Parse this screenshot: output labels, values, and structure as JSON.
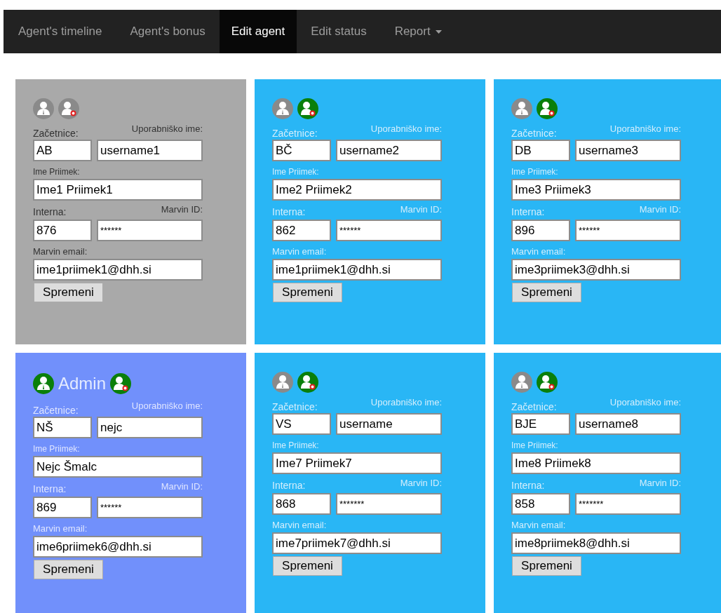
{
  "nav": [
    {
      "label": "Agent's timeline",
      "selected": false,
      "kind": "link"
    },
    {
      "label": "Agent's bonus",
      "selected": false,
      "kind": "link"
    },
    {
      "label": "Edit agent",
      "selected": true,
      "kind": "link"
    },
    {
      "label": "Edit status",
      "selected": false,
      "kind": "link"
    },
    {
      "label": "Report",
      "selected": false,
      "kind": "dropdown"
    }
  ],
  "cards": [
    {
      "kind": "inactive",
      "agent_icon_active": false,
      "status_icon_active": false,
      "initials_label": "Začetnice:",
      "initials": "AB",
      "username_label": "Uporabniško ime:",
      "username": "username1",
      "name_label": "Ime Priimek:",
      "name": "Ime1 Priimek1",
      "extension_label": "Interna:",
      "extension": "876",
      "marvin_id_label": "Marvin ID:",
      "marvin_id": "******",
      "email_label": "Marvin email:",
      "email": "ime1priimek1@dhh.si",
      "button": "Spremeni"
    },
    {
      "kind": "agent",
      "agent_icon_active": false,
      "status_icon_active": true,
      "initials_label": "Začetnice:",
      "initials": "BČ",
      "username_label": "Uporabniško ime:",
      "username": "username2",
      "name_label": "Ime Priimek:",
      "name": "Ime2 Priimek2",
      "extension_label": "Interna:",
      "extension": "862",
      "marvin_id_label": "Marvin ID:",
      "marvin_id": "******",
      "email_label": "Marvin email:",
      "email": "ime1priimek1@dhh.si",
      "button": "Spremeni"
    },
    {
      "kind": "agent",
      "agent_icon_active": false,
      "status_icon_active": true,
      "initials_label": "Začetnice:",
      "initials": "DB",
      "username_label": "Uporabniško ime:",
      "username": "username3",
      "name_label": "Ime Priimek:",
      "name": "Ime3 Priimek3",
      "extension_label": "Interna:",
      "extension": "896",
      "marvin_id_label": "Marvin ID:",
      "marvin_id": "******",
      "email_label": "Marvin email:",
      "email": "ime3priimek3@dhh.si",
      "button": "Spremeni"
    },
    {
      "kind": "admin",
      "title": "Admin",
      "agent_icon_active": true,
      "status_icon_active": true,
      "initials_label": "Začetnice:",
      "initials": "NŠ",
      "username_label": "Uporabniško ime:",
      "username": "nejc",
      "name_label": "Ime Priimek:",
      "name": "Nejc Šmalc",
      "extension_label": "Interna:",
      "extension": "869",
      "marvin_id_label": "Marvin ID:",
      "marvin_id": "******",
      "email_label": "Marvin email:",
      "email": "ime6priimek6@dhh.si",
      "button": "Spremeni"
    },
    {
      "kind": "agent",
      "agent_icon_active": false,
      "status_icon_active": true,
      "initials_label": "Začetnice:",
      "initials": "VS",
      "username_label": "Uporabniško ime:",
      "username": "username",
      "name_label": "Ime Priimek:",
      "name": "Ime7 Priimek7",
      "extension_label": "Interna:",
      "extension": "868",
      "marvin_id_label": "Marvin ID:",
      "marvin_id": "*******",
      "email_label": "Marvin email:",
      "email": "ime7priimek7@dhh.si",
      "button": "Spremeni"
    },
    {
      "kind": "agent",
      "agent_icon_active": false,
      "status_icon_active": true,
      "initials_label": "Začetnice:",
      "initials": "BJE",
      "username_label": "Uporabniško ime:",
      "username": "username8",
      "name_label": "Ime Priimek:",
      "name": "Ime8 Priimek8",
      "extension_label": "Interna:",
      "extension": "858",
      "marvin_id_label": "Marvin ID:",
      "marvin_id": "*******",
      "email_label": "Marvin email:",
      "email": "ime8priimek8@dhh.si",
      "button": "Spremeni"
    }
  ]
}
